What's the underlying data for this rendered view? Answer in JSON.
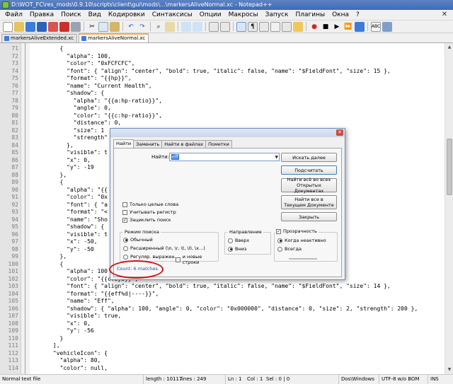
{
  "window": {
    "title": "D:\\WOT_FC\\res_mods\\0.9.10\\scripts\\client\\gui\\mods\\...\\markersAliveNormal.xc - Notepad++"
  },
  "menu": [
    "Файл",
    "Правка",
    "Поиск",
    "Вид",
    "Кодировки",
    "Синтаксисы",
    "Опции",
    "Макросы",
    "Запуск",
    "Плагины",
    "Окна",
    "?"
  ],
  "tabs": [
    {
      "label": "markersAliveExtended.xc"
    },
    {
      "label": "markersAliveNormal.xc"
    }
  ],
  "editor": {
    "lines": [
      {
        "n": "71",
        "t": "        {"
      },
      {
        "n": "72",
        "t": "          \"alpha\": 100,"
      },
      {
        "n": "73",
        "t": "          \"color\": \"0xFCFCFC\","
      },
      {
        "n": "74",
        "t": "          \"font\": { \"align\": \"center\", \"bold\": true, \"italic\": false, \"name\": \"$FieldFont\", \"size\": 15 },"
      },
      {
        "n": "75",
        "t": "          \"format\": \"{{hp}}\","
      },
      {
        "n": "76",
        "t": "          \"name\": \"Current Health\","
      },
      {
        "n": "77",
        "t": "          \"shadow\": {"
      },
      {
        "n": "78",
        "t": "            \"alpha\": \"{{a:hp-ratio}}\","
      },
      {
        "n": "79",
        "t": "            \"angle\": 0,"
      },
      {
        "n": "80",
        "t": "            \"color\": \"{{c:hp-ratio}}\","
      },
      {
        "n": "81",
        "t": "            \"distance\": 0,"
      },
      {
        "n": "82",
        "t": "            \"size\": 1"
      },
      {
        "n": "83",
        "t": "            \"strength\""
      },
      {
        "n": "84",
        "t": "          },"
      },
      {
        "n": "85",
        "t": "          \"visible\": t"
      },
      {
        "n": "86",
        "t": "          \"x\": 0,"
      },
      {
        "n": "87",
        "t": "          \"y\": -19"
      },
      {
        "n": "88",
        "t": "        },"
      },
      {
        "n": "89",
        "t": "        {"
      },
      {
        "n": "90",
        "t": "          \"alpha\": \"{{"
      },
      {
        "n": "91",
        "t": "          \"color\": \"0x"
      },
      {
        "n": "92",
        "t": "          \"font\": { \"a                                                          size\": 15 },"
      },
      {
        "n": "93",
        "t": "          \"format\": \"<                                                    t='60'>\","
      },
      {
        "n": "94",
        "t": "          \"name\": \"Sho"
      },
      {
        "n": "95",
        "t": "          \"shadow\": {                                                  \"strength\": 170 },"
      },
      {
        "n": "96",
        "t": "          \"visible\": t"
      },
      {
        "n": "97",
        "t": "          \"x\": -50,"
      },
      {
        "n": "98",
        "t": "          \"y\": -50"
      },
      {
        "n": "99",
        "t": "        },"
      },
      {
        "n": "100",
        "t": "        {"
      },
      {
        "n": "101",
        "t": "          \"alpha\": 100"
      },
      {
        "n": "102",
        "t": "          \"color\": \"{{c:sys}}\","
      },
      {
        "n": "103",
        "t": "          \"font\": { \"align\": \"center\", \"bold\": true, \"italic\": false, \"name\": \"$FieldFont\", \"size\": 14 },"
      },
      {
        "n": "104",
        "t": "          \"format\": \"{{eff%d|----}}\","
      },
      {
        "n": "105",
        "t": "          \"name\": \"Eff\","
      },
      {
        "n": "106",
        "t": "          \"shadow\": { \"alpha\": 100, \"angle\": 0, \"color\": \"0x000000\", \"distance\": 0, \"size\": 2, \"strength\": 200 },"
      },
      {
        "n": "107",
        "t": "          \"visible\": true,"
      },
      {
        "n": "108",
        "t": "          \"x\": 0,"
      },
      {
        "n": "109",
        "t": "          \"y\": -56"
      },
      {
        "n": "110",
        "t": "        }"
      },
      {
        "n": "111",
        "t": "      ],"
      },
      {
        "n": "112",
        "t": "      \"vehicleIcon\": {"
      },
      {
        "n": "113",
        "t": "        \"alpha\": 80,"
      },
      {
        "n": "114",
        "t": "        \"color\": null,"
      }
    ]
  },
  "status": {
    "file_type": "Normal text file",
    "length": "length : 10117",
    "lines": "lines : 249",
    "ln": "Ln : 1",
    "col": "Col : 1",
    "sel": "Sel : 0 | 0",
    "eol": "Dos\\Windows",
    "encoding": "UTF-8 w/o BOM",
    "mode": "INS"
  },
  "find_dialog": {
    "tabs": [
      "Найти",
      "Заменить",
      "Найти в файлах",
      "Пометки"
    ],
    "find_label": "Найти:",
    "find_value": "eff",
    "buttons": {
      "find_next": "Искать далее",
      "count": "Подсчитать",
      "find_all_open": [
        "Найти всё во всех",
        "Открытых Документах"
      ],
      "find_all_current": [
        "Найти все в",
        "Текущем Документе"
      ],
      "close": "Закрыть"
    },
    "options": {
      "whole_word": "Только целые слова",
      "match_case": "Учитывать регистр",
      "wrap": "Зациклить поиск"
    },
    "search_mode": {
      "title": "Режим поиска",
      "normal": "Обычный",
      "extended": "Расширенный (\\n, \\r, \\t, \\0, \\x...)",
      "regex": "Регуляр. выражен.",
      "newline": "и новые строки"
    },
    "direction": {
      "title": "Направление",
      "up": "Вверх",
      "down": "Вниз"
    },
    "transparency": {
      "title": "Прозрачность",
      "inactive": "Когда неактивно",
      "always": "Всегда"
    },
    "result": "Count: 6 matches."
  },
  "colors": {
    "annotation_circle": "#d21414",
    "selection": "#3b74d6"
  }
}
